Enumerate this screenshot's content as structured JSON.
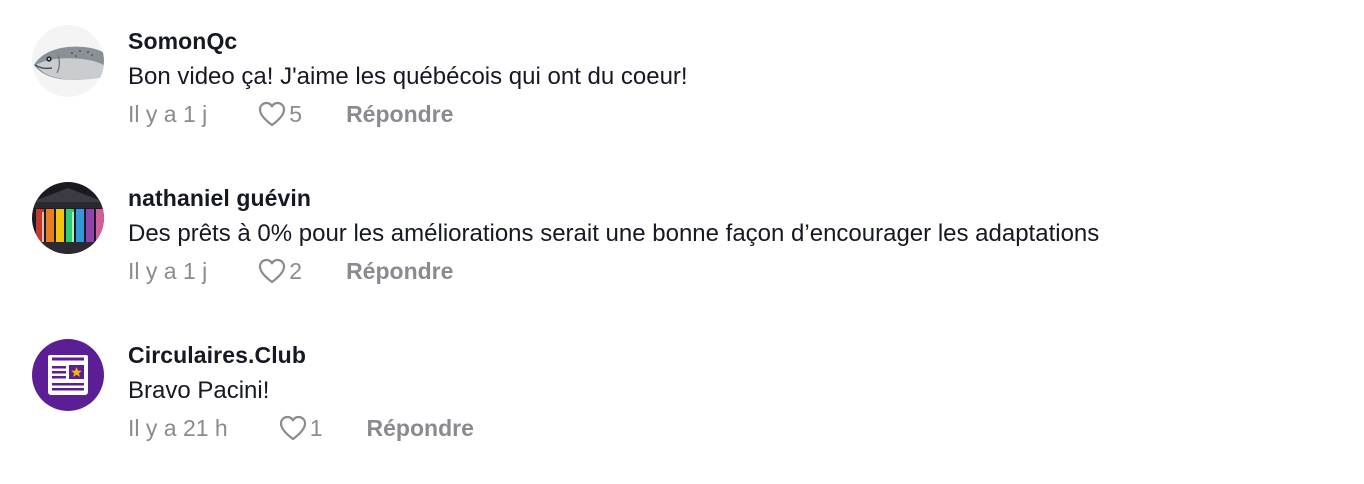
{
  "comments": [
    {
      "username": "SomonQc",
      "text": "Bon video ça! J'aime les québécois qui ont du coeur!",
      "time": "Il y a 1 j",
      "likes": "5",
      "reply_label": "Répondre",
      "avatar_icon": "salmon-avatar"
    },
    {
      "username": "nathaniel guévin",
      "text": "Des prêts à 0% pour les améliorations serait une bonne façon d’encourager les adaptations",
      "time": "Il y a 1 j",
      "likes": "2",
      "reply_label": "Répondre",
      "avatar_icon": "building-rainbow-lights-avatar"
    },
    {
      "username": "Circulaires.Club",
      "text": "Bravo Pacini!",
      "time": "Il y a 21 h",
      "likes": "1",
      "reply_label": "Répondre",
      "avatar_icon": "newspaper-star-avatar",
      "avatar_color": "#5b1e94"
    }
  ],
  "colors": {
    "text_primary": "#161823",
    "text_secondary": "#8a8b91",
    "background": "#ffffff"
  }
}
